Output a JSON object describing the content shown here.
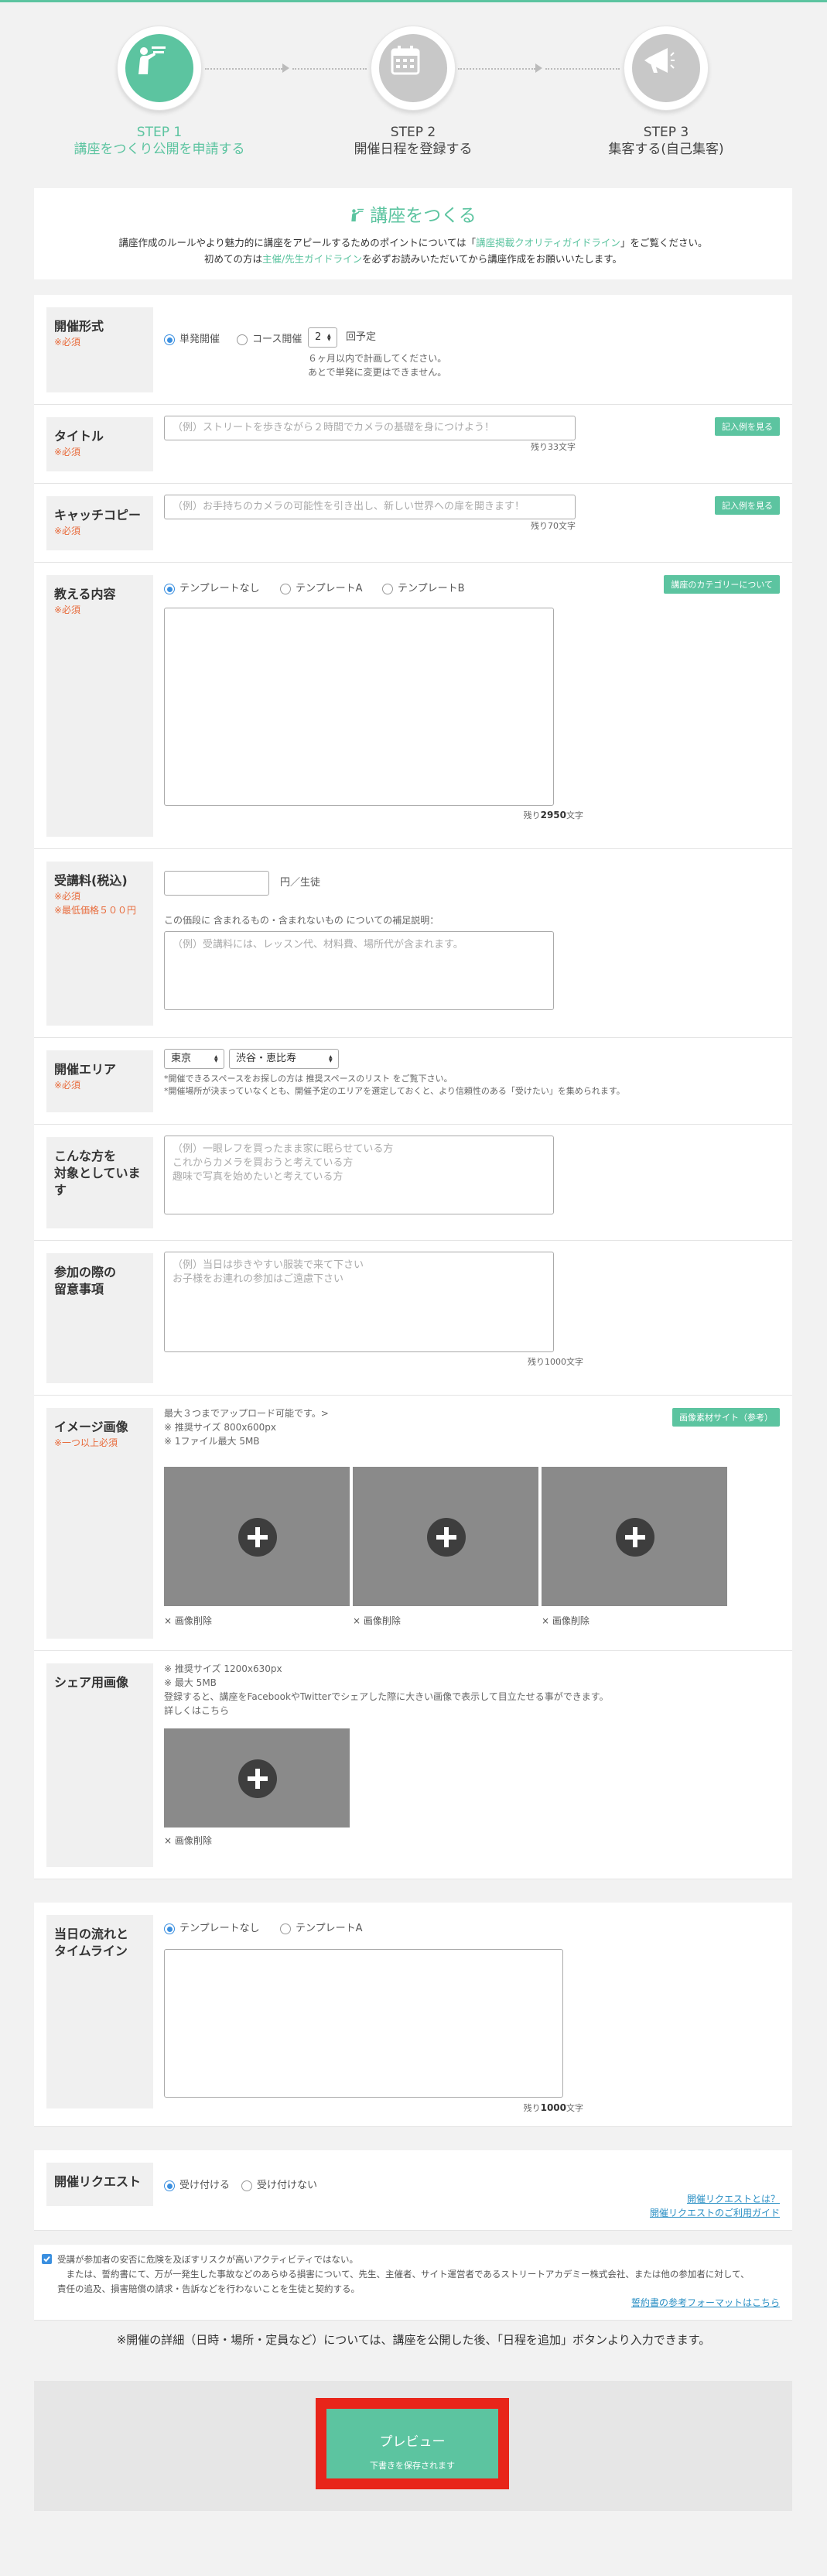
{
  "steps": [
    {
      "num": "STEP 1",
      "label": "講座をつくり公開を申請する",
      "icon": "teacher-icon",
      "active": true
    },
    {
      "num": "STEP 2",
      "label": "開催日程を登録する",
      "icon": "calendar-icon",
      "active": false
    },
    {
      "num": "STEP 3",
      "label": "集客する(自己集客)",
      "icon": "megaphone-icon",
      "active": false
    }
  ],
  "intro": {
    "title": "講座をつくる",
    "line1_pre": "講座作成のルールやより魅力的に講座をアピールするためのポイントについては「",
    "line1_link": "講座掲載クオリティガイドライン",
    "line1_post": "」をご覧ください。",
    "line2_pre": "初めての方は",
    "line2_link": "主催/先生ガイドライン",
    "line2_post": "を必ずお読みいただいてから講座作成をお願いいたします。"
  },
  "required": "※必須",
  "format": {
    "label": "開催形式",
    "opt_single": "単発開催",
    "opt_course": "コース開催",
    "count": "2",
    "count_suffix": "回予定",
    "note": "６ヶ月以内で計画してください。\nあとで単発に変更はできません。"
  },
  "title_field": {
    "label": "タイトル",
    "placeholder": "（例）ストリートを歩きながら２時間でカメラの基礎を身につけよう！",
    "counter": "残り33文字",
    "example_btn": "記入例を見る"
  },
  "catch": {
    "label": "キャッチコピー",
    "placeholder": "（例）お手持ちのカメラの可能性を引き出し、新しい世界への扉を開きます！",
    "counter": "残り70文字",
    "example_btn": "記入例を見る"
  },
  "content": {
    "label": "教える内容",
    "opt_none": "テンプレートなし",
    "opt_a": "テンプレートA",
    "opt_b": "テンプレートB",
    "category_btn": "講座のカテゴリーについて",
    "counter_pre": "残り",
    "counter_num": "2950",
    "counter_post": "文字"
  },
  "fee": {
    "label": "受講料(税込)",
    "min_price": "※最低価格５００円",
    "unit": "円／生徒",
    "desc": "この価段に 含まれるもの・含まれないもの についての補足説明：",
    "placeholder": "（例）受講料には、レッスン代、材料費、場所代が含まれます。"
  },
  "area": {
    "label": "開催エリア",
    "pref": "東京",
    "city": "渋谷・恵比寿",
    "note1": "*開催できるスペースをお探しの方は 推奨スペースのリスト をご覧下さい。",
    "note2": "*開催場所が決まっていなくとも、開催予定のエリアを選定しておくと、より信頼性のある「受けたい」を集められます。"
  },
  "target": {
    "label": "こんな方を\n対象としています",
    "placeholder": "（例）一眼レフを買ったまま家に眠らせている方\nこれからカメラを買おうと考えている方\n趣味で写真を始めたいと考えている方"
  },
  "notes": {
    "label": "参加の際の\n留意事項",
    "placeholder": "（例）当日は歩きやすい服装で来て下さい\nお子様をお連れの参加はご遠慮下さい",
    "counter": "残り1000文字"
  },
  "images": {
    "label": "イメージ画像",
    "req": "※一つ以上必須",
    "info": "最大３つまでアップロード可能です。>\n※ 推奨サイズ 800x600px\n※ 1ファイル最大 5MB",
    "btn": "画像素材サイト（参考）",
    "delete": "× 画像削除"
  },
  "share": {
    "label": "シェア用画像",
    "info": "※ 推奨サイズ 1200x630px\n※ 最大 5MB\n登録すると、講座をFacebookやTwitterでシェアした際に大きい画像で表示して目立たせる事ができます。\n詳しくはこちら",
    "delete": "× 画像削除"
  },
  "timeline": {
    "label": "当日の流れと\nタイムライン",
    "opt_none": "テンプレートなし",
    "opt_a": "テンプレートA",
    "counter_pre": "残り",
    "counter_num": "1000",
    "counter_post": "文字"
  },
  "request": {
    "label": "開催リクエスト",
    "opt_accept": "受け付ける",
    "opt_reject": "受け付けない",
    "link1": "開催リクエストとは？",
    "link2": "開催リクエストのご利用ガイド"
  },
  "agreement": {
    "text": "受講が参加者の安否に危険を及ぼすリスクが高いアクティビティではない。\n　または、誓約書にて、万が一発生した事故などのあらゆる損害について、先生、主催者、サイト運営者であるストリートアカデミー株式会社、または他の参加者に対して、\n責任の追及、損害賠償の請求・告訴などを行わないことを生徒と契約する。",
    "link": "誓約書の参考フォーマットはこちら"
  },
  "footer_note": "※開催の詳細（日時・場所・定員など）については、講座を公開した後、「日程を追加」ボタンより入力できます。",
  "preview": {
    "label": "プレビュー",
    "sub": "下書きを保存されます"
  },
  "colors": {
    "accent": "#5cc4a0",
    "required": "#e86a3a",
    "highlight": "#e8251a",
    "link": "#2a8fc4"
  }
}
